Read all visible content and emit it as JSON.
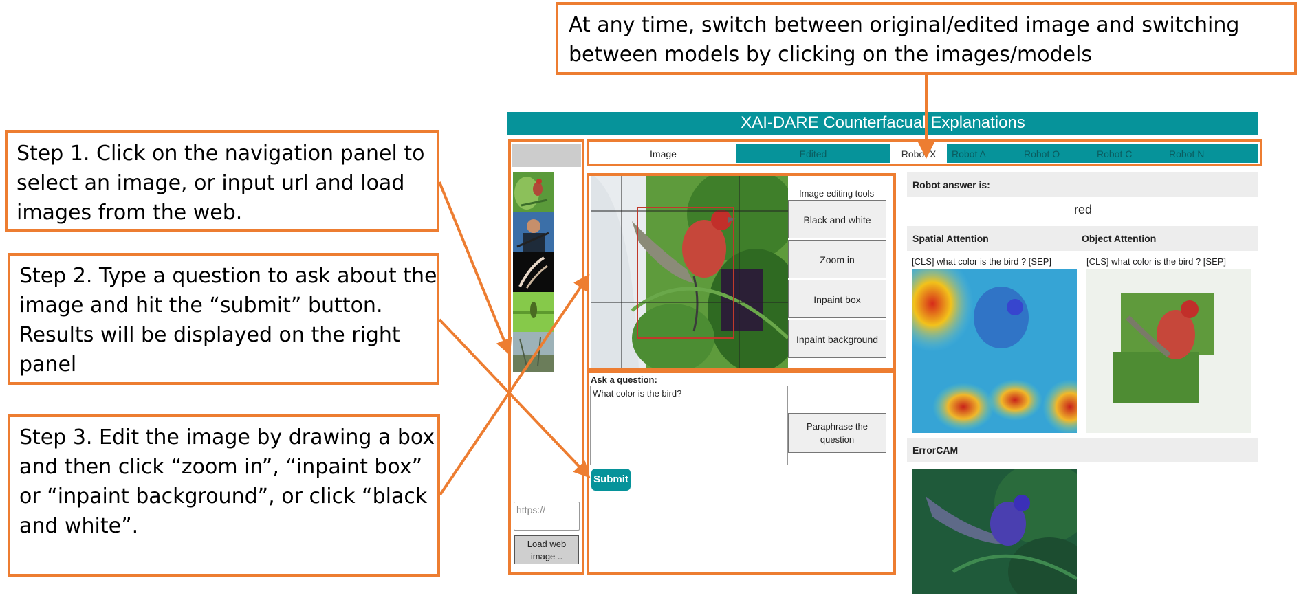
{
  "callouts": {
    "top": [
      "At any time, switch between original/edited image and switching",
      "between models by clicking on the images/models"
    ],
    "step1": [
      "Step 1. Click on the navigation panel to",
      "select an image, or input url and load",
      "images from the web."
    ],
    "step2": [
      "Step 2. Type a question to ask about the",
      "image and hit the “submit” button.",
      "Results will be displayed on the right",
      "panel"
    ],
    "step3": [
      "Step 3. Edit the image by drawing a box",
      "and then click “zoom in”, “inpaint box”",
      "or “inpaint background”, or click “black",
      "and white”."
    ]
  },
  "app": {
    "title": "XAI-DARE Counterfacual Explanations",
    "tabs": {
      "image": "Image",
      "edited": "Edited",
      "models": [
        "Robot X",
        "Robot A",
        "Robot O",
        "Robot C",
        "Robot N"
      ]
    },
    "sidebar": {
      "url_placeholder": "https://",
      "load_button": "Load web image .."
    },
    "editor": {
      "tools_label": "Image editing tools",
      "tools": [
        "Black and white",
        "Zoom in",
        "Inpaint box",
        "Inpaint background"
      ],
      "question_label": "Ask a question:",
      "question_value": "What color is the bird?",
      "paraphrase_button": "Paraphrase the question",
      "submit_button": "Submit"
    },
    "results": {
      "answer_label": "Robot answer is:",
      "answer": "red",
      "spatial_label": "Spatial Attention",
      "object_label": "Object Attention",
      "spatial_caption": "[CLS] what color is the bird ? [SEP]",
      "object_caption": "[CLS] what color is the bird ? [SEP]",
      "errorcam_label": "ErrorCAM"
    }
  },
  "colors": {
    "accent": "#ED7D31",
    "teal": "#06939A"
  }
}
